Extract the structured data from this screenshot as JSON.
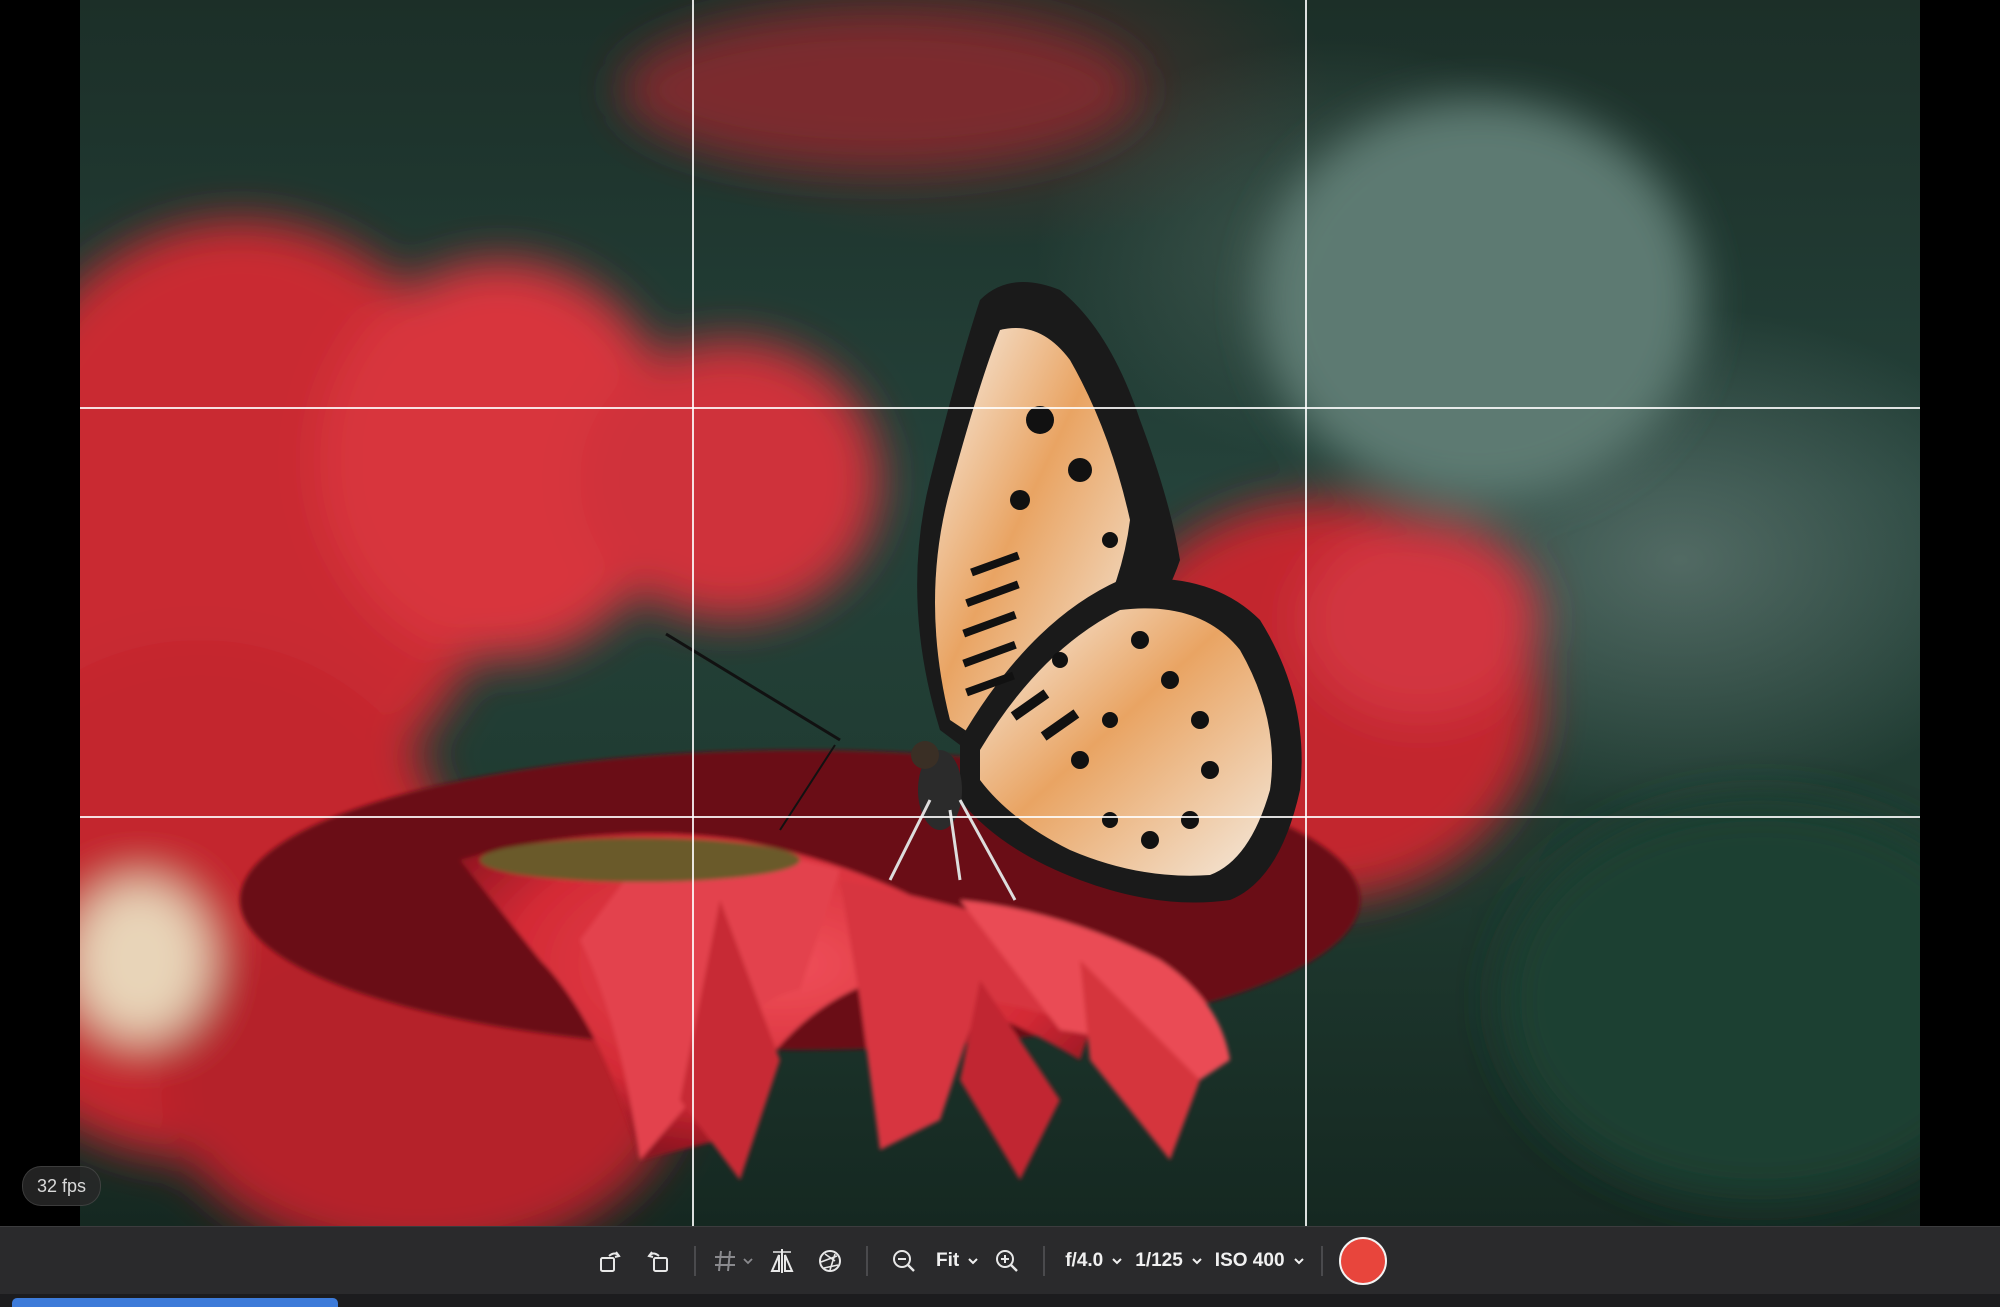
{
  "viewer": {
    "fps_label": "32 fps",
    "grid_overlay": "rule-of-thirds"
  },
  "toolbar": {
    "rotate_left_icon": "rotate-left-icon",
    "rotate_right_icon": "rotate-right-icon",
    "grid_icon": "grid-icon",
    "flip_icon": "flip-horizontal-icon",
    "aperture_icon": "aperture-icon",
    "zoom_out_icon": "zoom-out-icon",
    "zoom_level": "Fit",
    "zoom_in_icon": "zoom-in-icon",
    "aperture_value": "f/4.0",
    "shutter_speed": "1/125",
    "iso": "ISO 400",
    "shutter_button_color": "#e8453c"
  },
  "colors": {
    "toolbar_bg": "#2a2a2c",
    "accent_blue": "#3d7bd9"
  }
}
